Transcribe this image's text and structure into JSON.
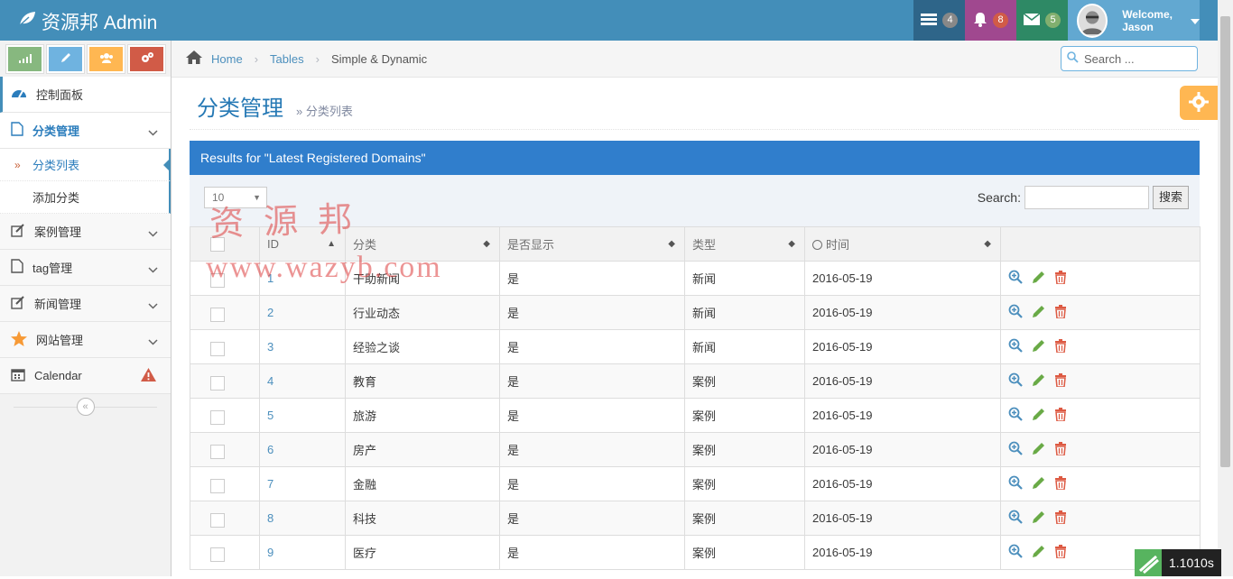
{
  "brand": {
    "title": "资源邦 Admin"
  },
  "navbar": {
    "tasks_count": "4",
    "notifications_count": "8",
    "messages_count": "5",
    "welcome": "Welcome,",
    "user": "Jason",
    "colors": {
      "tasks": "#2e6589",
      "notifications": "#a0488f",
      "messages": "#2e8965",
      "user": "#62a8d1"
    }
  },
  "breadcrumb": {
    "home": "Home",
    "tables": "Tables",
    "current": "Simple & Dynamic"
  },
  "search": {
    "placeholder": "Search ..."
  },
  "sidebar": {
    "dashboard": "控制面板",
    "category": "分类管理",
    "category_list": "分类列表",
    "category_add": "添加分类",
    "cases": "案例管理",
    "tags": "tag管理",
    "news": "新闻管理",
    "site": "网站管理",
    "calendar": "Calendar"
  },
  "page": {
    "title": "分类管理",
    "subtitle": "» 分类列表"
  },
  "table": {
    "header": "Results for \"Latest Registered Domains\"",
    "length": "10",
    "search_label": "Search:",
    "search_button": "搜索",
    "columns": [
      "ID",
      "分类",
      "是否显示",
      "类型",
      "时间"
    ],
    "rows": [
      {
        "id": "1",
        "name": "干助新闻",
        "show": "是",
        "type": "新闻",
        "date": "2016-05-19"
      },
      {
        "id": "2",
        "name": "行业动态",
        "show": "是",
        "type": "新闻",
        "date": "2016-05-19"
      },
      {
        "id": "3",
        "name": "经验之谈",
        "show": "是",
        "type": "新闻",
        "date": "2016-05-19"
      },
      {
        "id": "4",
        "name": "教育",
        "show": "是",
        "type": "案例",
        "date": "2016-05-19"
      },
      {
        "id": "5",
        "name": "旅游",
        "show": "是",
        "type": "案例",
        "date": "2016-05-19"
      },
      {
        "id": "6",
        "name": "房产",
        "show": "是",
        "type": "案例",
        "date": "2016-05-19"
      },
      {
        "id": "7",
        "name": "金融",
        "show": "是",
        "type": "案例",
        "date": "2016-05-19"
      },
      {
        "id": "8",
        "name": "科技",
        "show": "是",
        "type": "案例",
        "date": "2016-05-19"
      },
      {
        "id": "9",
        "name": "医疗",
        "show": "是",
        "type": "案例",
        "date": "2016-05-19"
      }
    ]
  },
  "watermark": {
    "line1": "资源邦",
    "line2": "www.wazyb.com"
  },
  "timer": {
    "value": "1.1010s"
  }
}
